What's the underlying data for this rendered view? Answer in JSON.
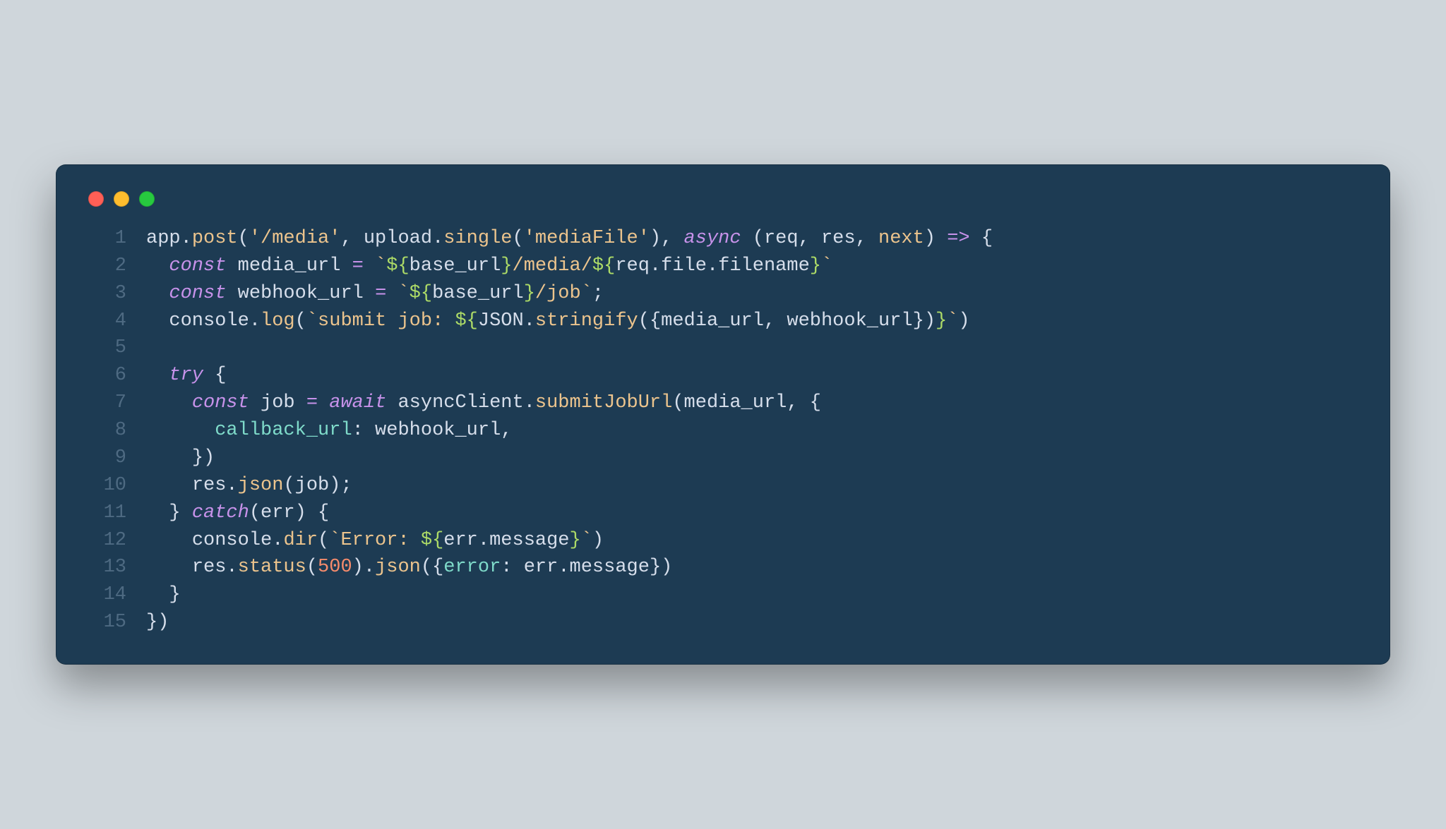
{
  "window": {
    "traffic_lights": {
      "red": "#ff5f56",
      "yellow": "#ffbd2e",
      "green": "#27c93f"
    },
    "bg": "#1d3b53"
  },
  "code": {
    "line_numbers": [
      "1",
      "2",
      "3",
      "4",
      "5",
      "6",
      "7",
      "8",
      "9",
      "10",
      "11",
      "12",
      "13",
      "14",
      "15"
    ],
    "lines": [
      [
        {
          "t": "app",
          "c": "tk-default"
        },
        {
          "t": ".",
          "c": "tk-punc"
        },
        {
          "t": "post",
          "c": "tk-fn"
        },
        {
          "t": "(",
          "c": "tk-punc"
        },
        {
          "t": "'/media'",
          "c": "tk-str"
        },
        {
          "t": ", ",
          "c": "tk-punc"
        },
        {
          "t": "upload",
          "c": "tk-default"
        },
        {
          "t": ".",
          "c": "tk-punc"
        },
        {
          "t": "single",
          "c": "tk-fn"
        },
        {
          "t": "(",
          "c": "tk-punc"
        },
        {
          "t": "'mediaFile'",
          "c": "tk-str"
        },
        {
          "t": ")",
          "c": "tk-punc"
        },
        {
          "t": ", ",
          "c": "tk-punc"
        },
        {
          "t": "async",
          "c": "tk-kw2"
        },
        {
          "t": " ",
          "c": "tk-punc"
        },
        {
          "t": "(",
          "c": "tk-punc"
        },
        {
          "t": "req",
          "c": "tk-default"
        },
        {
          "t": ", ",
          "c": "tk-punc"
        },
        {
          "t": "res",
          "c": "tk-default"
        },
        {
          "t": ", ",
          "c": "tk-punc"
        },
        {
          "t": "next",
          "c": "tk-fn"
        },
        {
          "t": ")",
          "c": "tk-punc"
        },
        {
          "t": " ",
          "c": "tk-punc"
        },
        {
          "t": "=>",
          "c": "tk-kw"
        },
        {
          "t": " ",
          "c": "tk-punc"
        },
        {
          "t": "{",
          "c": "tk-punc"
        }
      ],
      [
        {
          "t": "  ",
          "c": "tk-punc"
        },
        {
          "t": "const",
          "c": "tk-kw"
        },
        {
          "t": " media_url ",
          "c": "tk-default"
        },
        {
          "t": "=",
          "c": "tk-kw"
        },
        {
          "t": " ",
          "c": "tk-punc"
        },
        {
          "t": "`",
          "c": "tk-str"
        },
        {
          "t": "${",
          "c": "tk-tmpl"
        },
        {
          "t": "base_url",
          "c": "tk-default"
        },
        {
          "t": "}",
          "c": "tk-tmpl"
        },
        {
          "t": "/media/",
          "c": "tk-str"
        },
        {
          "t": "${",
          "c": "tk-tmpl"
        },
        {
          "t": "req",
          "c": "tk-default"
        },
        {
          "t": ".",
          "c": "tk-punc"
        },
        {
          "t": "file",
          "c": "tk-default"
        },
        {
          "t": ".",
          "c": "tk-punc"
        },
        {
          "t": "filename",
          "c": "tk-default"
        },
        {
          "t": "}",
          "c": "tk-tmpl"
        },
        {
          "t": "`",
          "c": "tk-str"
        }
      ],
      [
        {
          "t": "  ",
          "c": "tk-punc"
        },
        {
          "t": "const",
          "c": "tk-kw"
        },
        {
          "t": " webhook_url ",
          "c": "tk-default"
        },
        {
          "t": "=",
          "c": "tk-kw"
        },
        {
          "t": " ",
          "c": "tk-punc"
        },
        {
          "t": "`",
          "c": "tk-str"
        },
        {
          "t": "${",
          "c": "tk-tmpl"
        },
        {
          "t": "base_url",
          "c": "tk-default"
        },
        {
          "t": "}",
          "c": "tk-tmpl"
        },
        {
          "t": "/job",
          "c": "tk-str"
        },
        {
          "t": "`",
          "c": "tk-str"
        },
        {
          "t": ";",
          "c": "tk-punc"
        }
      ],
      [
        {
          "t": "  ",
          "c": "tk-punc"
        },
        {
          "t": "console",
          "c": "tk-default"
        },
        {
          "t": ".",
          "c": "tk-punc"
        },
        {
          "t": "log",
          "c": "tk-fn"
        },
        {
          "t": "(",
          "c": "tk-punc"
        },
        {
          "t": "`",
          "c": "tk-str"
        },
        {
          "t": "submit job: ",
          "c": "tk-str"
        },
        {
          "t": "${",
          "c": "tk-tmpl"
        },
        {
          "t": "JSON",
          "c": "tk-default"
        },
        {
          "t": ".",
          "c": "tk-punc"
        },
        {
          "t": "stringify",
          "c": "tk-fn"
        },
        {
          "t": "(",
          "c": "tk-punc"
        },
        {
          "t": "{",
          "c": "tk-punc"
        },
        {
          "t": "media_url",
          "c": "tk-default"
        },
        {
          "t": ", ",
          "c": "tk-punc"
        },
        {
          "t": "webhook_url",
          "c": "tk-default"
        },
        {
          "t": "}",
          "c": "tk-punc"
        },
        {
          "t": ")",
          "c": "tk-punc"
        },
        {
          "t": "}",
          "c": "tk-tmpl"
        },
        {
          "t": "`",
          "c": "tk-str"
        },
        {
          "t": ")",
          "c": "tk-punc"
        }
      ],
      [
        {
          "t": "",
          "c": "tk-punc"
        }
      ],
      [
        {
          "t": "  ",
          "c": "tk-punc"
        },
        {
          "t": "try",
          "c": "tk-kw"
        },
        {
          "t": " {",
          "c": "tk-punc"
        }
      ],
      [
        {
          "t": "    ",
          "c": "tk-punc"
        },
        {
          "t": "const",
          "c": "tk-kw"
        },
        {
          "t": " job ",
          "c": "tk-default"
        },
        {
          "t": "=",
          "c": "tk-kw"
        },
        {
          "t": " ",
          "c": "tk-punc"
        },
        {
          "t": "await",
          "c": "tk-kw"
        },
        {
          "t": " asyncClient",
          "c": "tk-default"
        },
        {
          "t": ".",
          "c": "tk-punc"
        },
        {
          "t": "submitJobUrl",
          "c": "tk-fn"
        },
        {
          "t": "(",
          "c": "tk-punc"
        },
        {
          "t": "media_url",
          "c": "tk-default"
        },
        {
          "t": ", ",
          "c": "tk-punc"
        },
        {
          "t": "{",
          "c": "tk-punc"
        }
      ],
      [
        {
          "t": "      ",
          "c": "tk-punc"
        },
        {
          "t": "callback_url",
          "c": "tk-prop"
        },
        {
          "t": ":",
          "c": "tk-punc"
        },
        {
          "t": " webhook_url",
          "c": "tk-default"
        },
        {
          "t": ",",
          "c": "tk-punc"
        }
      ],
      [
        {
          "t": "    ",
          "c": "tk-punc"
        },
        {
          "t": "})",
          "c": "tk-punc"
        }
      ],
      [
        {
          "t": "    ",
          "c": "tk-punc"
        },
        {
          "t": "res",
          "c": "tk-default"
        },
        {
          "t": ".",
          "c": "tk-punc"
        },
        {
          "t": "json",
          "c": "tk-fn"
        },
        {
          "t": "(",
          "c": "tk-punc"
        },
        {
          "t": "job",
          "c": "tk-default"
        },
        {
          "t": ")",
          "c": "tk-punc"
        },
        {
          "t": ";",
          "c": "tk-punc"
        }
      ],
      [
        {
          "t": "  ",
          "c": "tk-punc"
        },
        {
          "t": "}",
          "c": "tk-punc"
        },
        {
          "t": " ",
          "c": "tk-punc"
        },
        {
          "t": "catch",
          "c": "tk-kw"
        },
        {
          "t": "(",
          "c": "tk-punc"
        },
        {
          "t": "err",
          "c": "tk-default"
        },
        {
          "t": ")",
          "c": "tk-punc"
        },
        {
          "t": " {",
          "c": "tk-punc"
        }
      ],
      [
        {
          "t": "    ",
          "c": "tk-punc"
        },
        {
          "t": "console",
          "c": "tk-default"
        },
        {
          "t": ".",
          "c": "tk-punc"
        },
        {
          "t": "dir",
          "c": "tk-fn"
        },
        {
          "t": "(",
          "c": "tk-punc"
        },
        {
          "t": "`",
          "c": "tk-str"
        },
        {
          "t": "Error: ",
          "c": "tk-str"
        },
        {
          "t": "${",
          "c": "tk-tmpl"
        },
        {
          "t": "err",
          "c": "tk-default"
        },
        {
          "t": ".",
          "c": "tk-punc"
        },
        {
          "t": "message",
          "c": "tk-default"
        },
        {
          "t": "}",
          "c": "tk-tmpl"
        },
        {
          "t": "`",
          "c": "tk-str"
        },
        {
          "t": ")",
          "c": "tk-punc"
        }
      ],
      [
        {
          "t": "    ",
          "c": "tk-punc"
        },
        {
          "t": "res",
          "c": "tk-default"
        },
        {
          "t": ".",
          "c": "tk-punc"
        },
        {
          "t": "status",
          "c": "tk-fn"
        },
        {
          "t": "(",
          "c": "tk-punc"
        },
        {
          "t": "500",
          "c": "tk-num"
        },
        {
          "t": ")",
          "c": "tk-punc"
        },
        {
          "t": ".",
          "c": "tk-punc"
        },
        {
          "t": "json",
          "c": "tk-fn"
        },
        {
          "t": "(",
          "c": "tk-punc"
        },
        {
          "t": "{",
          "c": "tk-punc"
        },
        {
          "t": "error",
          "c": "tk-prop"
        },
        {
          "t": ":",
          "c": "tk-punc"
        },
        {
          "t": " err",
          "c": "tk-default"
        },
        {
          "t": ".",
          "c": "tk-punc"
        },
        {
          "t": "message",
          "c": "tk-default"
        },
        {
          "t": "}",
          "c": "tk-punc"
        },
        {
          "t": ")",
          "c": "tk-punc"
        }
      ],
      [
        {
          "t": "  ",
          "c": "tk-punc"
        },
        {
          "t": "}",
          "c": "tk-punc"
        }
      ],
      [
        {
          "t": "})",
          "c": "tk-punc"
        }
      ]
    ]
  }
}
